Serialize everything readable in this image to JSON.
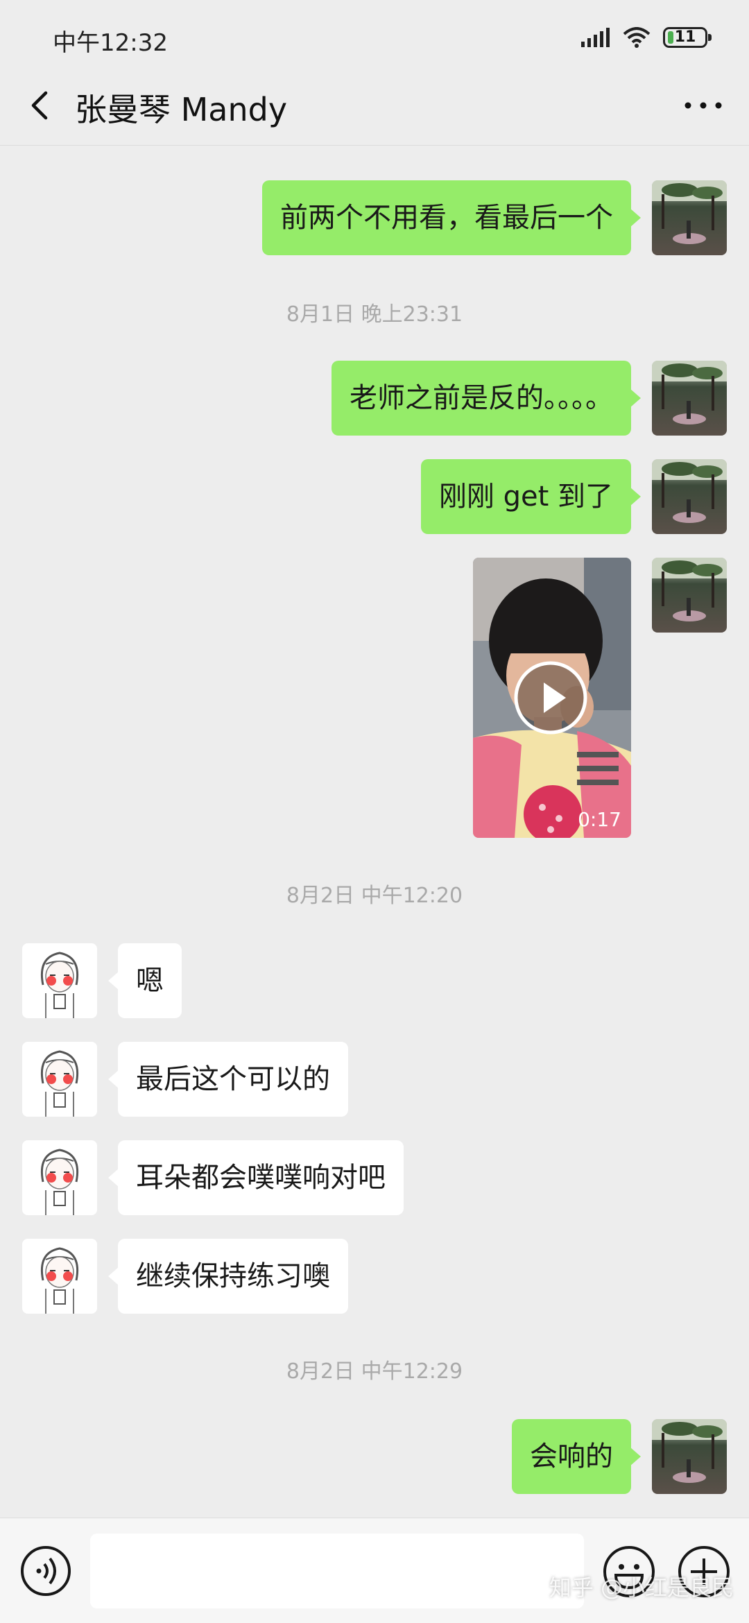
{
  "status_bar": {
    "time": "中午12:32",
    "battery": "11"
  },
  "header": {
    "title": "张曼琴 Mandy",
    "back_icon": "chevron-left-icon",
    "more_icon": "more-dots-icon"
  },
  "messages": [
    {
      "type": "outgoing",
      "text": "前两个不用看，看最后一个"
    },
    {
      "type": "timestamp",
      "text": "8月1日 晚上23:31"
    },
    {
      "type": "outgoing",
      "text": "老师之前是反的。。。。"
    },
    {
      "type": "outgoing",
      "text": "刚刚 get 到了"
    },
    {
      "type": "outgoing-video",
      "duration": "0:17"
    },
    {
      "type": "timestamp",
      "text": "8月2日 中午12:20"
    },
    {
      "type": "incoming",
      "text": "嗯"
    },
    {
      "type": "incoming",
      "text": "最后这个可以的"
    },
    {
      "type": "incoming",
      "text": "耳朵都会噗噗响对吧"
    },
    {
      "type": "incoming",
      "text": "继续保持练习噢"
    },
    {
      "type": "timestamp",
      "text": "8月2日 中午12:29"
    },
    {
      "type": "outgoing",
      "text": "会响的"
    }
  ],
  "input_bar": {
    "voice_icon": "voice-icon",
    "emoji_icon": "emoji-icon",
    "plus_icon": "plus-icon",
    "value": ""
  },
  "watermark": "知乎 @小红是良民",
  "colors": {
    "outgoing_bubble": "#95ec69",
    "incoming_bubble": "#ffffff",
    "background": "#ededed"
  }
}
